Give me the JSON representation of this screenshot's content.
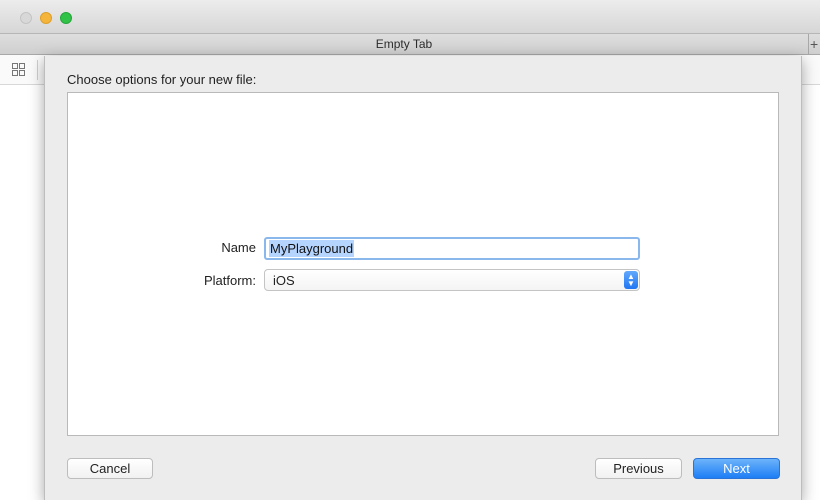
{
  "window": {
    "tab_title": "Empty Tab",
    "tab_add": "+"
  },
  "dialog": {
    "heading": "Choose options for your new file:",
    "name_label": "Name",
    "name_value": "MyPlayground",
    "platform_label": "Platform:",
    "platform_value": "iOS",
    "cancel_label": "Cancel",
    "previous_label": "Previous",
    "next_label": "Next"
  },
  "icons": {
    "toolbar": "grid-icon",
    "select": "up-down-chevron-icon"
  },
  "colors": {
    "accent": "#1e7ef5",
    "selection": "#b5d4fe",
    "minimize": "#f5b53a",
    "maximize": "#31c248"
  }
}
